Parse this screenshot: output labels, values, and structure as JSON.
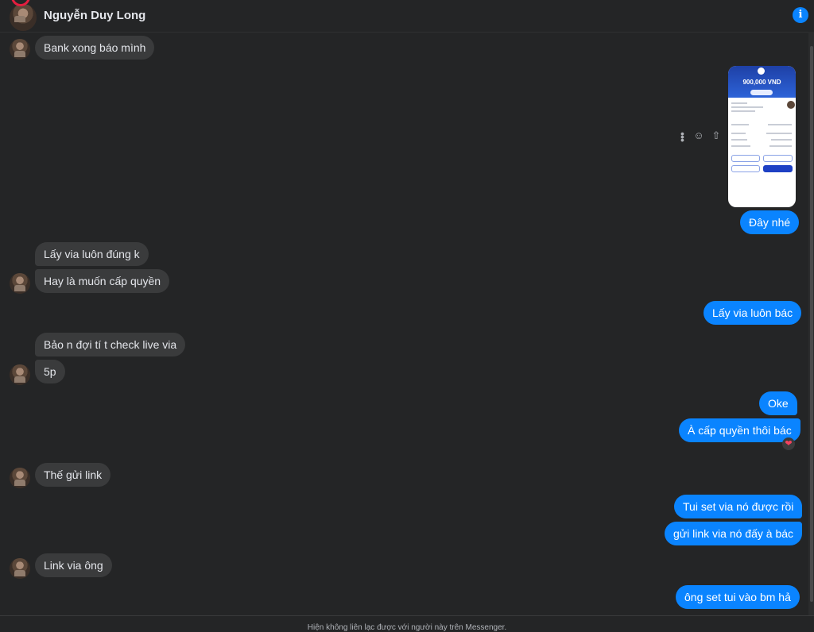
{
  "header": {
    "contact_name": "Nguyễn Duy Long",
    "info_icon": "i"
  },
  "attachment": {
    "amount": "900,000 VND"
  },
  "messages": {
    "m1": "Bank xong báo mình",
    "m2": "Đây nhé",
    "m3": "Lấy via luôn đúng k",
    "m4": "Hay là muốn cấp quyền",
    "m5": "Lấy via luôn bác",
    "m6": "Bảo n đợi tí t check live via",
    "m7": "5p",
    "m8": "Oke",
    "m9": "À cấp quyền thôi bác",
    "m10": "Thế gửi link",
    "m11": "Tui set via nó được rồi",
    "m12": "gửi link via nó đấy à bác",
    "m13": "Link via ông",
    "m14": "ông set tui vào bm hả"
  },
  "reaction": "❤",
  "footer": {
    "notice": "Hiện không liên lạc được với người này trên Messenger."
  },
  "colors": {
    "outgoing": "#0a84ff",
    "incoming": "#3a3b3c",
    "background": "#242526"
  },
  "icons": [
    "info-icon",
    "more-options-icon",
    "react-icon",
    "share-icon",
    "heart-reaction-icon"
  ]
}
